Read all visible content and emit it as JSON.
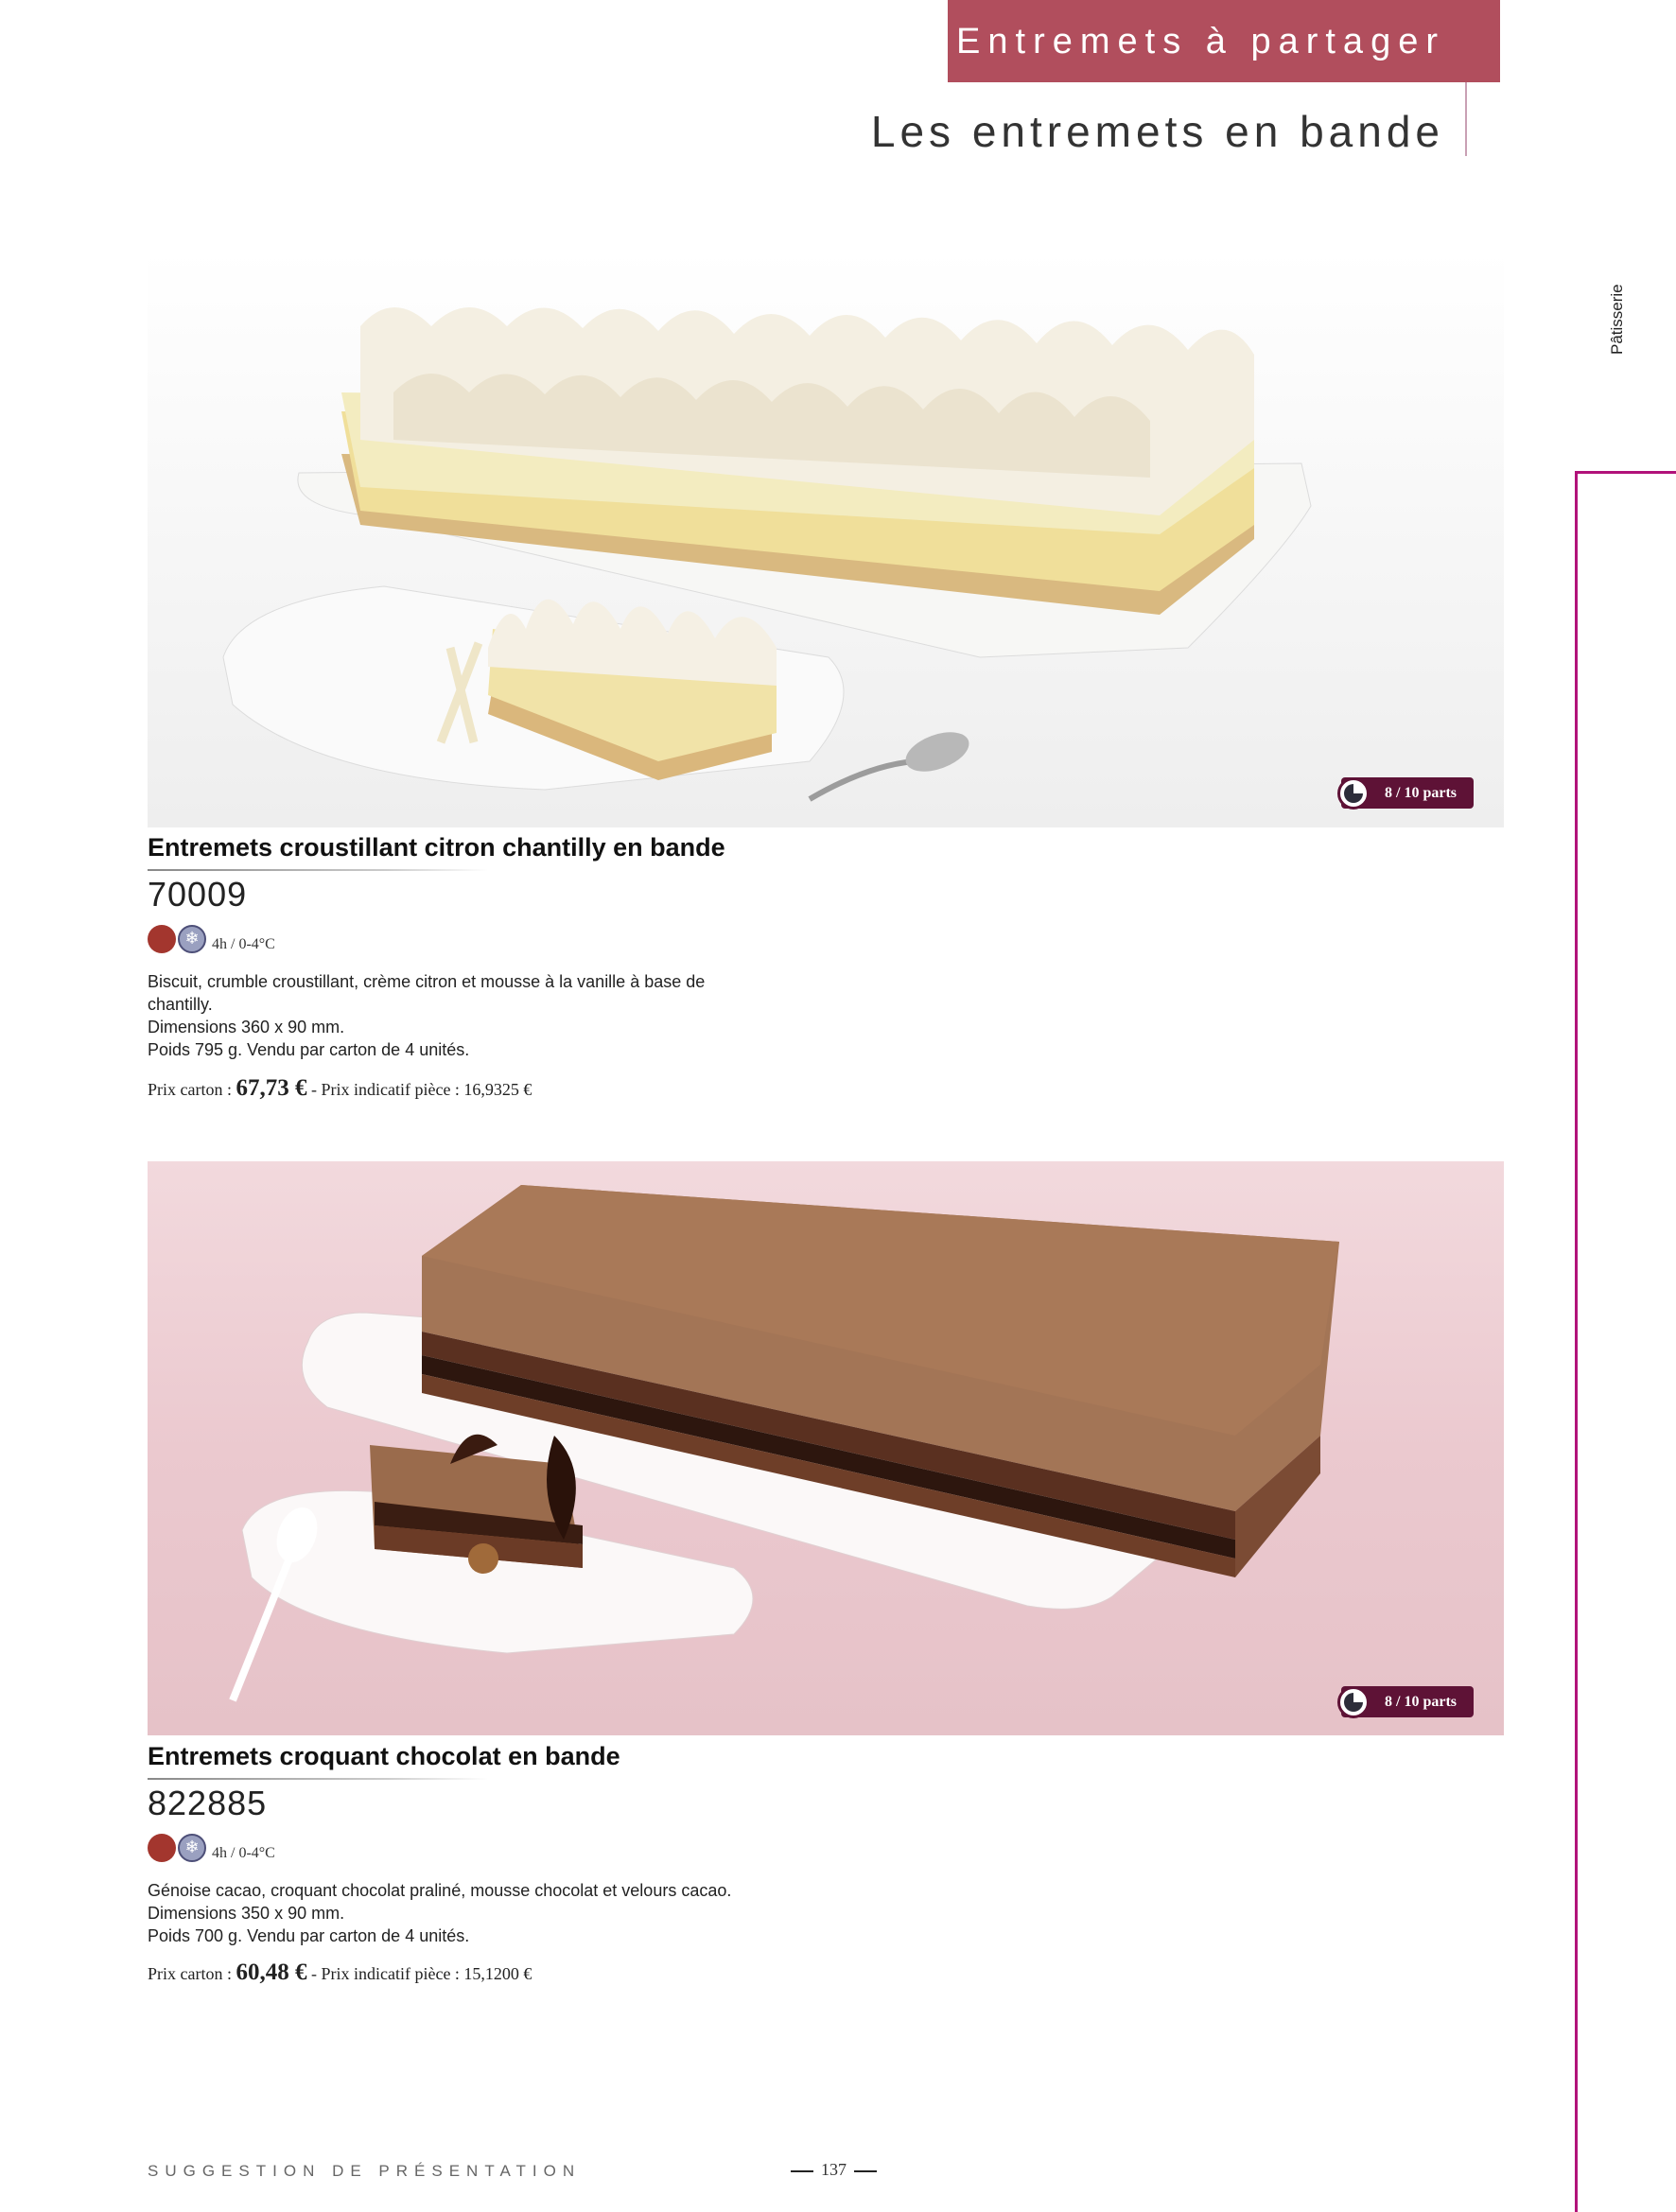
{
  "header": {
    "category": "Entremets à partager",
    "subtitle": "Les entremets en bande"
  },
  "side": {
    "label": "Pâtisserie"
  },
  "products": [
    {
      "title": "Entremets croustillant citron chantilly en bande",
      "code": "70009",
      "portions": "8 / 10 parts",
      "thaw": "4h / 0-4°C",
      "description": "Biscuit, crumble croustillant, crème citron et mousse à la vanille à base de chantilly.",
      "dimensions": "Dimensions 360 x 90 mm.",
      "weight": "Poids 795 g. Vendu par carton de 4 unités.",
      "price_label": "Prix carton : ",
      "price": "67,73 €",
      "unit_price": " - Prix indicatif pièce : 16,9325 €"
    },
    {
      "title": "Entremets croquant chocolat en bande",
      "code": "822885",
      "portions": "8 / 10 parts",
      "thaw": "4h / 0-4°C",
      "description": "Génoise cacao, croquant chocolat praliné, mousse chocolat et velours cacao.",
      "dimensions": "Dimensions 350 x 90 mm.",
      "weight": "Poids 700 g. Vendu par carton de 4 unités.",
      "price_label": "Prix carton : ",
      "price": "60,48 €",
      "unit_price": " - Prix indicatif pièce : 15,1200 €"
    }
  ],
  "footer": {
    "note": "SUGGESTION DE PRÉSENTATION",
    "page": "137"
  },
  "colors": {
    "header_bg": "#b14e5d",
    "side_rule": "#b1127a",
    "badge": "#5e1236",
    "product_dot": "#a3362e"
  },
  "icons": [
    "snowflake-icon",
    "portion-icon"
  ]
}
